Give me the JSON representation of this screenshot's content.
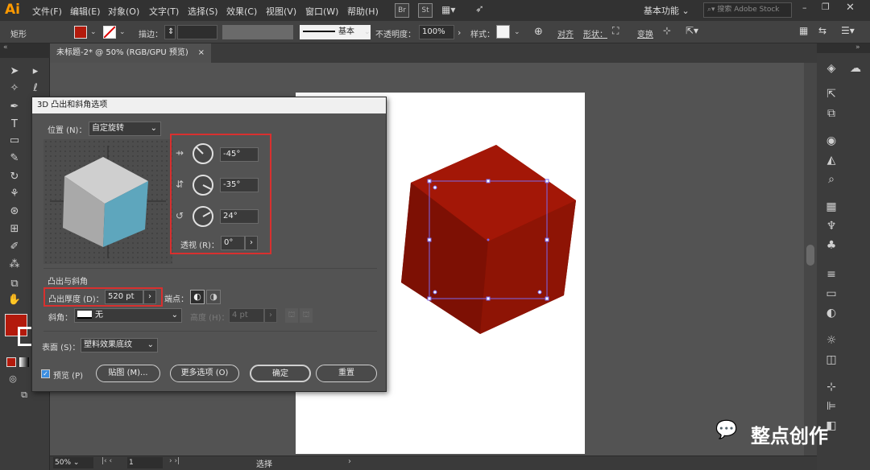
{
  "app": {
    "logo": "Ai"
  },
  "menu": [
    "文件(F)",
    "编辑(E)",
    "对象(O)",
    "文字(T)",
    "选择(S)",
    "效果(C)",
    "视图(V)",
    "窗口(W)",
    "帮助(H)"
  ],
  "menubar_badges": [
    "Br",
    "St"
  ],
  "workspace": {
    "label": "基本功能",
    "search_placeholder": "搜索 Adobe Stock"
  },
  "control_bar": {
    "shape_label": "矩形",
    "fill_color": "#b31a0c",
    "stroke_label": "描边：",
    "stroke_style_label": "基本",
    "opacity_label": "不透明度：",
    "opacity_value": "100%",
    "style_label": "样式：",
    "align_label": "对齐",
    "shape_label2": "形状：",
    "transform_label": "变换"
  },
  "document_tab": {
    "title": "未标题-2* @ 50% (RGB/GPU 预览)",
    "close": "×"
  },
  "dialog": {
    "title": "3D 凸出和斜角选项",
    "position_label": "位置 (N)：",
    "position_value": "自定旋转",
    "rotation_x": "-45°",
    "rotation_y": "-35°",
    "rotation_z": "24°",
    "perspective_label": "透视 (R)：",
    "perspective_value": "0°",
    "extrude_section": "凸出与斜角",
    "extrude_depth_label": "凸出厚度 (D)：",
    "extrude_depth_value": "520 pt",
    "cap_label": "端点：",
    "bevel_label": "斜角：",
    "bevel_value": "无",
    "height_label": "高度 (H)：",
    "height_value": "4 pt",
    "surface_label": "表面 (S)：",
    "surface_value": "塑料效果底纹",
    "preview_label": "预览 (P)",
    "map_button": "贴图 (M)...",
    "more_options_button": "更多选项 (O)",
    "ok_button": "确定",
    "reset_button": "重置",
    "cube_colors": {
      "top": "#cfcfcf",
      "left": "#a9a9a9",
      "right": "#5ea6bd"
    }
  },
  "canvas": {
    "cube_colors": {
      "top": "#a31707",
      "left": "#7d1004",
      "right": "#8e1405"
    },
    "selection_color": "#7b68ee"
  },
  "status_bar": {
    "zoom": "50%",
    "page": "1",
    "tool": "选择"
  },
  "watermark": {
    "text": "整点创作"
  },
  "accent": {
    "highlight_border": "#d8302f",
    "fill_swatch": "#b31a0c"
  }
}
